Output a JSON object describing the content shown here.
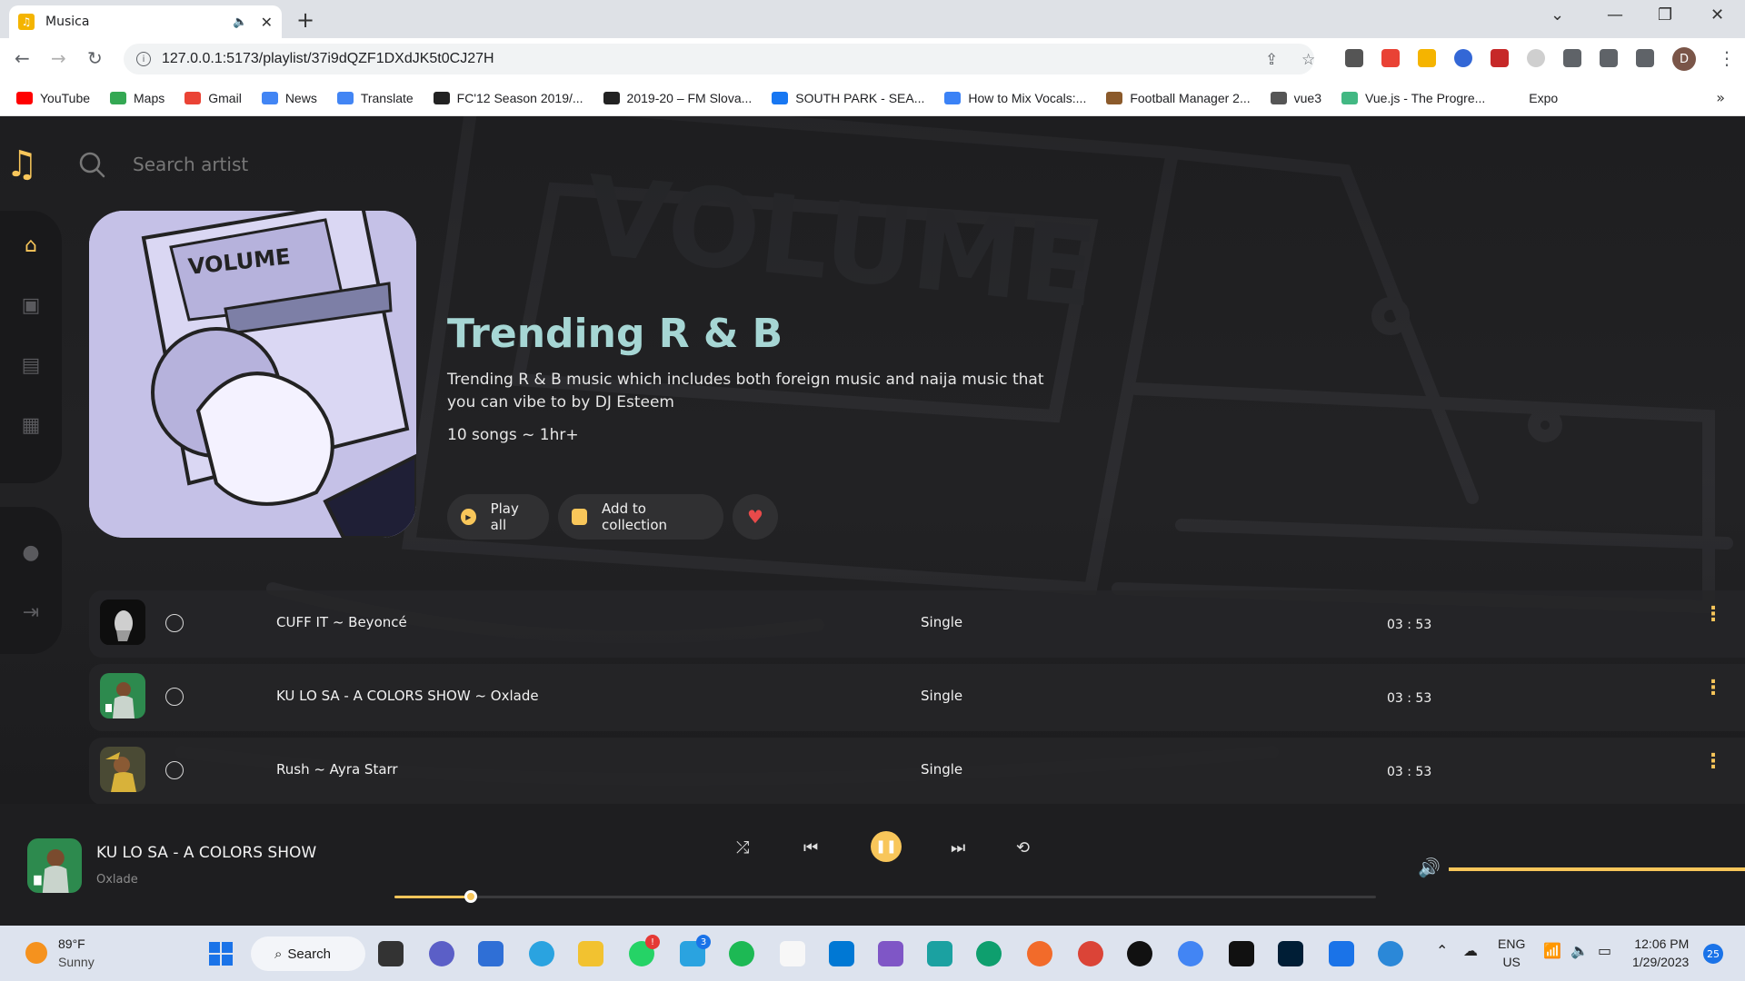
{
  "browser": {
    "tab_title": "Musica",
    "url": "127.0.0.1:5173/playlist/37i9dQZF1DXdJK5t0CJ27H",
    "bookmarks": [
      {
        "label": "YouTube",
        "color": "#ff0000"
      },
      {
        "label": "Maps",
        "color": "#34a853"
      },
      {
        "label": "Gmail",
        "color": "#ea4335"
      },
      {
        "label": "News",
        "color": "#4285f4"
      },
      {
        "label": "Translate",
        "color": "#4285f4"
      },
      {
        "label": "FC'12 Season 2019/...",
        "color": "#222222"
      },
      {
        "label": "2019-20 – FM Slova...",
        "color": "#222222"
      },
      {
        "label": "SOUTH PARK - SEA...",
        "color": "#1877f2"
      },
      {
        "label": "How to Mix Vocals:...",
        "color": "#3b82f6"
      },
      {
        "label": "Football Manager 2...",
        "color": "#8b5a2b"
      },
      {
        "label": "vue3",
        "color": "#555555"
      },
      {
        "label": "Vue.js - The Progre...",
        "color": "#42b883"
      },
      {
        "label": "Expo",
        "color": "#ffffff"
      }
    ],
    "profile_initial": "D"
  },
  "app": {
    "search_placeholder": "Search artist",
    "accent": "#f8c65a",
    "playlist": {
      "title": "Trending R & B",
      "description": "Trending R & B music which includes both foreign music and naija music that you can vibe to by DJ Esteem",
      "meta": "10 songs ~ 1hr+",
      "play_all_label": "Play all",
      "add_collection_label": "Add to collection"
    },
    "tracks": [
      {
        "name": "CUFF IT ~ Beyoncé",
        "type": "Single",
        "duration": "03 : 53"
      },
      {
        "name": "KU LO SA - A COLORS SHOW ~ Oxlade",
        "type": "Single",
        "duration": "03 : 53"
      },
      {
        "name": "Rush ~ Ayra Starr",
        "type": "Single",
        "duration": "03 : 53"
      }
    ],
    "now_playing": {
      "title": "KU LO SA - A COLORS SHOW",
      "artist": "Oxlade",
      "progress": 0.078,
      "volume": 1.0
    }
  },
  "taskbar": {
    "temperature": "89°F",
    "condition": "Sunny",
    "search_label": "Search",
    "lang_top": "ENG",
    "lang_bottom": "US",
    "time": "12:06 PM",
    "date": "1/29/2023",
    "notifications": "25",
    "whatsapp_badge": "!",
    "telegram_badge": "3"
  }
}
